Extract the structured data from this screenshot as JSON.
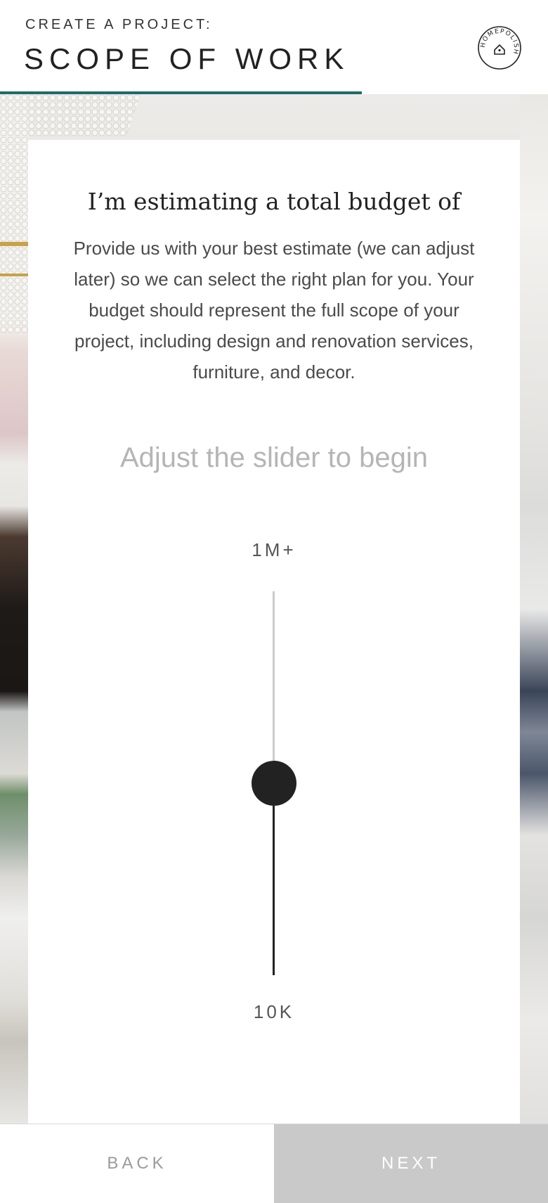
{
  "header": {
    "eyebrow": "CREATE A PROJECT:",
    "title": "SCOPE OF WORK",
    "logo_text": "HOMEPOLISH",
    "progress": 0.66,
    "accent_color": "#1f6b6b"
  },
  "card": {
    "heading": "I’m estimating a total budget of",
    "body": "Provide us with your best estimate (we can adjust later) so we can select the right plan for you. Your budget should represent the full scope of your project, including design and renovation services, furniture, and decor.",
    "slider_prompt": "Adjust the slider to begin",
    "slider": {
      "max_label": "1M+",
      "min_label": "10K",
      "value_fraction": 0.5
    }
  },
  "footer": {
    "back_label": "BACK",
    "next_label": "NEXT"
  }
}
